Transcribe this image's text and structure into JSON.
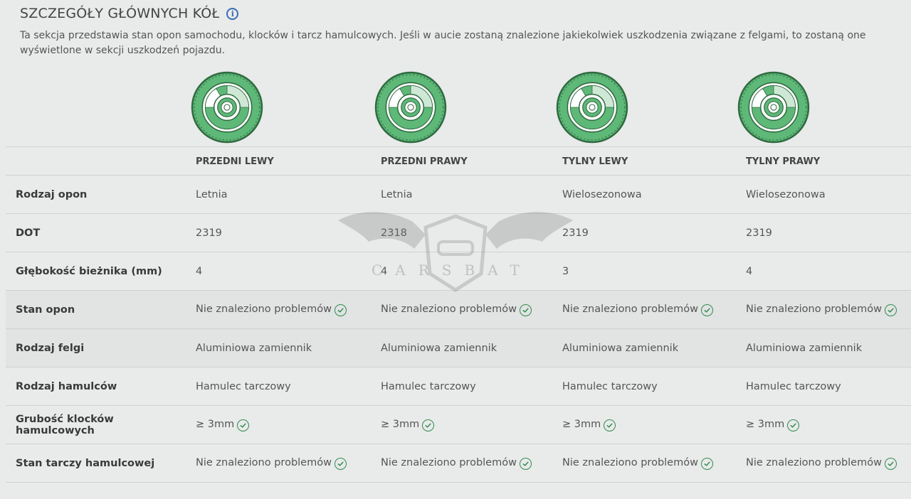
{
  "header": {
    "title": "SZCZEGÓŁY GŁÓWNYCH KÓŁ",
    "description": "Ta sekcja przedstawia stan opon samochodu, klocków i tarcz hamulcowych. Jeśli w aucie zostaną znalezione jakiekolwiek uszkodzenia związane z felgami, to zostaną one wyświetlone w sekcji uszkodzeń pojazdu."
  },
  "icons": {
    "info": "info-circle-icon",
    "check": "check-circle-icon",
    "wheel": "wheel-icon"
  },
  "colors": {
    "wheel_green": "#5eb878",
    "check_green": "#2f8c4f",
    "info_blue": "#3b6fb6"
  },
  "columns": [
    "PRZEDNI LEWY",
    "PRZEDNI PRAWY",
    "TYLNY LEWY",
    "TYLNY PRAWY"
  ],
  "rows": [
    {
      "label": "Rodzaj opon",
      "values": [
        "Letnia",
        "Letnia",
        "Wielosezonowa",
        "Wielosezonowa"
      ]
    },
    {
      "label": "DOT",
      "values": [
        "2319",
        "2318",
        "2319",
        "2319"
      ]
    },
    {
      "label": "Głębokość bieżnika (mm)",
      "values": [
        "4",
        "4",
        "3",
        "4"
      ]
    },
    {
      "label": "Stan opon",
      "values": [
        "Nie znaleziono problemów",
        "Nie znaleziono problemów",
        "Nie znaleziono problemów",
        "Nie znaleziono problemów"
      ]
    },
    {
      "label": "Rodzaj felgi",
      "values": [
        "Aluminiowa zamiennik",
        "Aluminiowa zamiennik",
        "Aluminiowa zamiennik",
        "Aluminiowa zamiennik"
      ]
    },
    {
      "label": "Rodzaj hamulców",
      "values": [
        "Hamulec tarczowy",
        "Hamulec tarczowy",
        "Hamulec tarczowy",
        "Hamulec tarczowy"
      ]
    },
    {
      "label": "Grubość klocków hamulcowych",
      "values": [
        "≥ 3mm",
        "≥ 3mm",
        "≥ 3mm",
        "≥ 3mm"
      ]
    },
    {
      "label": "Stan tarczy hamulcowej",
      "values": [
        "Nie znaleziono problemów",
        "Nie znaleziono problemów",
        "Nie znaleziono problemów",
        "Nie znaleziono problemów"
      ]
    }
  ],
  "watermark": {
    "text": "CARSBAT"
  }
}
